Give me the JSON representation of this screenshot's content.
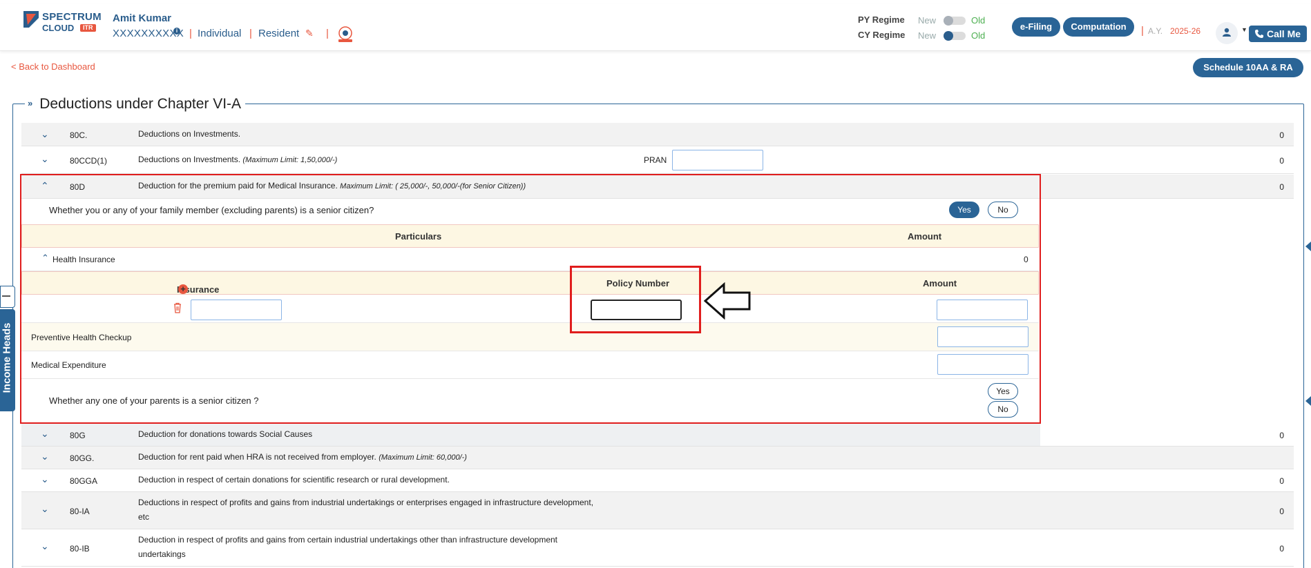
{
  "header": {
    "logo_line1": "SPECTRUM",
    "logo_line2": "CLOUD",
    "logo_badge": "ITR",
    "user_name": "Amit Kumar",
    "user_pan": "XXXXXXXXXX",
    "user_type": "Individual",
    "residency": "Resident",
    "py_regime_label": "PY Regime",
    "cy_regime_label": "CY Regime",
    "new_label": "New",
    "old_label": "Old",
    "efiling_label": "e-Filing",
    "computation_label": "Computation",
    "ay_label": "A.Y.",
    "ay_value": "2025-26",
    "call_me_label": "Call Me"
  },
  "nav": {
    "back_label": "< Back to Dashboard",
    "schedule_label": "Schedule 10AA & RA"
  },
  "section": {
    "title": "Deductions under Chapter VI-A"
  },
  "rows": {
    "r80c": {
      "code": "80C.",
      "desc": "Deductions on Investments.",
      "value": "0"
    },
    "r80ccd": {
      "code": "80CCD(1)",
      "desc": "Deductions on Investments.",
      "note": "(Maximum Limit: 1,50,000/-)",
      "pran_label": "PRAN",
      "value": "0"
    },
    "r80d": {
      "code": "80D",
      "desc": "Deduction for the premium paid for Medical Insurance.",
      "note": "Maximum Limit: ( 25,000/-, 50,000/-(for Senior Citizen))",
      "value": "0"
    },
    "r80g": {
      "code": "80G",
      "desc": "Deduction for donations towards Social Causes",
      "value": "0"
    },
    "r80gg": {
      "code": "80GG.",
      "desc": "Deduction for rent paid when HRA is not received from employer.",
      "note": "(Maximum Limit: 60,000/-)"
    },
    "r80gga": {
      "code": "80GGA",
      "desc": "Deduction in respect of certain donations for scientific research or rural development.",
      "value": "0"
    },
    "r80ia": {
      "code": "80-IA",
      "desc1": "Deductions in respect of profits and gains from industrial undertakings or enterprises engaged in infrastructure development,",
      "desc2": "etc",
      "value": "0"
    },
    "r80ib": {
      "code": "80-IB",
      "desc1": "Deduction in respect of profits and gains from certain industrial undertakings other than infrastructure development",
      "desc2": "undertakings",
      "value": "0"
    }
  },
  "d80": {
    "q_family": "Whether you or any of your family member (excluding parents) is a senior citizen?",
    "yes_label": "Yes",
    "no_label": "No",
    "particulars_header": "Particulars",
    "amount_header": "Amount",
    "health_insurance_label": "Health Insurance",
    "health_insurance_value": "0",
    "insurance_company_header": "Insurance Company",
    "policy_number_header": "Policy Number",
    "amount_header2": "Amount",
    "preventive_label": "Preventive Health Checkup",
    "medical_exp_label": "Medical Expenditure",
    "q_parents": "Whether any one of your parents is a senior citizen ?"
  },
  "sidebar": {
    "income_heads_label": "Income Heads"
  },
  "colors": {
    "brand_blue": "#2a6496",
    "accent_orange": "#e8573f",
    "highlight_red": "#e01d1d"
  }
}
